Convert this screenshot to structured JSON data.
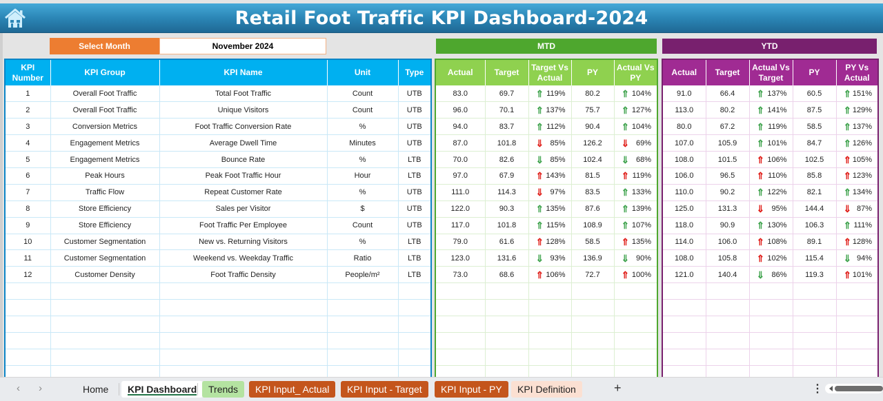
{
  "title": "Retail Foot Traffic KPI Dashboard-2024",
  "home_icon": "home-icon",
  "select_month": {
    "label": "Select Month",
    "value": "November 2024"
  },
  "sections": {
    "mtd": "MTD",
    "ytd": "YTD"
  },
  "colors": {
    "header_gradient_top": "#45a9d8",
    "header_gradient_bottom": "#1f6894",
    "select_label": "#ed7d31",
    "kpi_header": "#00b0f0",
    "mtd_band": "#4ea72e",
    "mtd_header": "#8fd14f",
    "ytd_band": "#78206e",
    "ytd_header": "#a02b93",
    "arrow_good": "#3fa34d",
    "arrow_bad": "#e0201b"
  },
  "kpi_headers": [
    "KPI Number",
    "KPI Group",
    "KPI Name",
    "Unit",
    "Type"
  ],
  "mtd_headers": [
    "Actual",
    "Target",
    "Target Vs Actual",
    "PY",
    "Actual Vs PY"
  ],
  "ytd_headers": [
    "Actual",
    "Target",
    "Actual Vs Target",
    "PY",
    "PY Vs Actual"
  ],
  "rows": [
    {
      "num": "1",
      "group": "Overall Foot Traffic",
      "name": "Total Foot Traffic",
      "unit": "Count",
      "type": "UTB",
      "mtd": {
        "actual": "83.0",
        "target": "69.7",
        "tva": "119%",
        "tva_dir": "up",
        "tva_status": "good",
        "py": "80.2",
        "avp": "104%",
        "avp_dir": "up",
        "avp_status": "good"
      },
      "ytd": {
        "actual": "91.0",
        "target": "66.4",
        "avt": "137%",
        "avt_dir": "up",
        "avt_status": "good",
        "py": "60.5",
        "pva": "151%",
        "pva_dir": "up",
        "pva_status": "good"
      }
    },
    {
      "num": "2",
      "group": "Overall Foot Traffic",
      "name": "Unique Visitors",
      "unit": "Count",
      "type": "UTB",
      "mtd": {
        "actual": "96.0",
        "target": "70.1",
        "tva": "137%",
        "tva_dir": "up",
        "tva_status": "good",
        "py": "75.7",
        "avp": "127%",
        "avp_dir": "up",
        "avp_status": "good"
      },
      "ytd": {
        "actual": "113.0",
        "target": "80.2",
        "avt": "141%",
        "avt_dir": "up",
        "avt_status": "good",
        "py": "87.5",
        "pva": "129%",
        "pva_dir": "up",
        "pva_status": "good"
      }
    },
    {
      "num": "3",
      "group": "Conversion Metrics",
      "name": "Foot Traffic Conversion Rate",
      "unit": "%",
      "type": "UTB",
      "mtd": {
        "actual": "94.0",
        "target": "83.7",
        "tva": "112%",
        "tva_dir": "up",
        "tva_status": "good",
        "py": "90.4",
        "avp": "104%",
        "avp_dir": "up",
        "avp_status": "good"
      },
      "ytd": {
        "actual": "80.0",
        "target": "67.2",
        "avt": "119%",
        "avt_dir": "up",
        "avt_status": "good",
        "py": "58.5",
        "pva": "137%",
        "pva_dir": "up",
        "pva_status": "good"
      }
    },
    {
      "num": "4",
      "group": "Engagement Metrics",
      "name": "Average Dwell Time",
      "unit": "Minutes",
      "type": "UTB",
      "mtd": {
        "actual": "87.0",
        "target": "101.8",
        "tva": "85%",
        "tva_dir": "down",
        "tva_status": "bad",
        "py": "126.2",
        "avp": "69%",
        "avp_dir": "down",
        "avp_status": "bad"
      },
      "ytd": {
        "actual": "107.0",
        "target": "105.9",
        "avt": "101%",
        "avt_dir": "up",
        "avt_status": "good",
        "py": "84.7",
        "pva": "126%",
        "pva_dir": "up",
        "pva_status": "good"
      }
    },
    {
      "num": "5",
      "group": "Engagement Metrics",
      "name": "Bounce Rate",
      "unit": "%",
      "type": "LTB",
      "mtd": {
        "actual": "70.0",
        "target": "82.6",
        "tva": "85%",
        "tva_dir": "down",
        "tva_status": "good",
        "py": "102.4",
        "avp": "68%",
        "avp_dir": "down",
        "avp_status": "good"
      },
      "ytd": {
        "actual": "108.0",
        "target": "101.5",
        "avt": "106%",
        "avt_dir": "up",
        "avt_status": "bad",
        "py": "102.5",
        "pva": "105%",
        "pva_dir": "up",
        "pva_status": "bad"
      }
    },
    {
      "num": "6",
      "group": "Peak Hours",
      "name": "Peak Foot Traffic Hour",
      "unit": "Hour",
      "type": "LTB",
      "mtd": {
        "actual": "97.0",
        "target": "67.9",
        "tva": "143%",
        "tva_dir": "up",
        "tva_status": "bad",
        "py": "81.5",
        "avp": "119%",
        "avp_dir": "up",
        "avp_status": "bad"
      },
      "ytd": {
        "actual": "106.0",
        "target": "96.5",
        "avt": "110%",
        "avt_dir": "up",
        "avt_status": "bad",
        "py": "85.8",
        "pva": "123%",
        "pva_dir": "up",
        "pva_status": "bad"
      }
    },
    {
      "num": "7",
      "group": "Traffic Flow",
      "name": "Repeat Customer Rate",
      "unit": "%",
      "type": "UTB",
      "mtd": {
        "actual": "111.0",
        "target": "114.3",
        "tva": "97%",
        "tva_dir": "down",
        "tva_status": "bad",
        "py": "83.5",
        "avp": "133%",
        "avp_dir": "up",
        "avp_status": "good"
      },
      "ytd": {
        "actual": "110.0",
        "target": "90.2",
        "avt": "122%",
        "avt_dir": "up",
        "avt_status": "good",
        "py": "82.1",
        "pva": "134%",
        "pva_dir": "up",
        "pva_status": "good"
      }
    },
    {
      "num": "8",
      "group": "Store Efficiency",
      "name": "Sales per Visitor",
      "unit": "$",
      "type": "UTB",
      "mtd": {
        "actual": "122.0",
        "target": "90.3",
        "tva": "135%",
        "tva_dir": "up",
        "tva_status": "good",
        "py": "87.6",
        "avp": "139%",
        "avp_dir": "up",
        "avp_status": "good"
      },
      "ytd": {
        "actual": "125.0",
        "target": "131.3",
        "avt": "95%",
        "avt_dir": "down",
        "avt_status": "bad",
        "py": "144.4",
        "pva": "87%",
        "pva_dir": "down",
        "pva_status": "bad"
      }
    },
    {
      "num": "9",
      "group": "Store Efficiency",
      "name": "Foot Traffic Per Employee",
      "unit": "Count",
      "type": "UTB",
      "mtd": {
        "actual": "117.0",
        "target": "101.8",
        "tva": "115%",
        "tva_dir": "up",
        "tva_status": "good",
        "py": "108.9",
        "avp": "107%",
        "avp_dir": "up",
        "avp_status": "good"
      },
      "ytd": {
        "actual": "118.0",
        "target": "90.9",
        "avt": "130%",
        "avt_dir": "up",
        "avt_status": "good",
        "py": "106.3",
        "pva": "111%",
        "pva_dir": "up",
        "pva_status": "good"
      }
    },
    {
      "num": "10",
      "group": "Customer Segmentation",
      "name": "New vs. Returning Visitors",
      "unit": "%",
      "type": "LTB",
      "mtd": {
        "actual": "79.0",
        "target": "61.6",
        "tva": "128%",
        "tva_dir": "up",
        "tva_status": "bad",
        "py": "58.5",
        "avp": "135%",
        "avp_dir": "up",
        "avp_status": "bad"
      },
      "ytd": {
        "actual": "114.0",
        "target": "106.0",
        "avt": "108%",
        "avt_dir": "up",
        "avt_status": "bad",
        "py": "89.1",
        "pva": "128%",
        "pva_dir": "up",
        "pva_status": "bad"
      }
    },
    {
      "num": "11",
      "group": "Customer Segmentation",
      "name": "Weekend vs. Weekday Traffic",
      "unit": "Ratio",
      "type": "LTB",
      "mtd": {
        "actual": "123.0",
        "target": "131.6",
        "tva": "93%",
        "tva_dir": "down",
        "tva_status": "good",
        "py": "136.9",
        "avp": "90%",
        "avp_dir": "down",
        "avp_status": "good"
      },
      "ytd": {
        "actual": "108.0",
        "target": "105.8",
        "avt": "102%",
        "avt_dir": "up",
        "avt_status": "bad",
        "py": "115.4",
        "pva": "94%",
        "pva_dir": "down",
        "pva_status": "good"
      }
    },
    {
      "num": "12",
      "group": "Customer Density",
      "name": "Foot Traffic Density",
      "unit": "People/m²",
      "type": "LTB",
      "mtd": {
        "actual": "73.0",
        "target": "68.6",
        "tva": "106%",
        "tva_dir": "up",
        "tva_status": "bad",
        "py": "72.7",
        "avp": "100%",
        "avp_dir": "up",
        "avp_status": "bad"
      },
      "ytd": {
        "actual": "121.0",
        "target": "140.4",
        "avt": "86%",
        "avt_dir": "down",
        "avt_status": "good",
        "py": "119.3",
        "pva": "101%",
        "pva_dir": "up",
        "pva_status": "bad"
      }
    }
  ],
  "empty_rows": 6,
  "sheet_tabs": [
    {
      "label": "Home",
      "style": "plain"
    },
    {
      "label": "KPI Dashboard",
      "style": "active"
    },
    {
      "label": "Trends",
      "style": "green"
    },
    {
      "label": "KPI Input_ Actual",
      "style": "orange"
    },
    {
      "label": "KPI Input - Target",
      "style": "orange"
    },
    {
      "label": "KPI Input - PY",
      "style": "orange"
    },
    {
      "label": "KPI Definition",
      "style": "peach"
    }
  ],
  "tabbar": {
    "prev": "‹",
    "next": "›",
    "add": "+",
    "more": "⋮"
  }
}
